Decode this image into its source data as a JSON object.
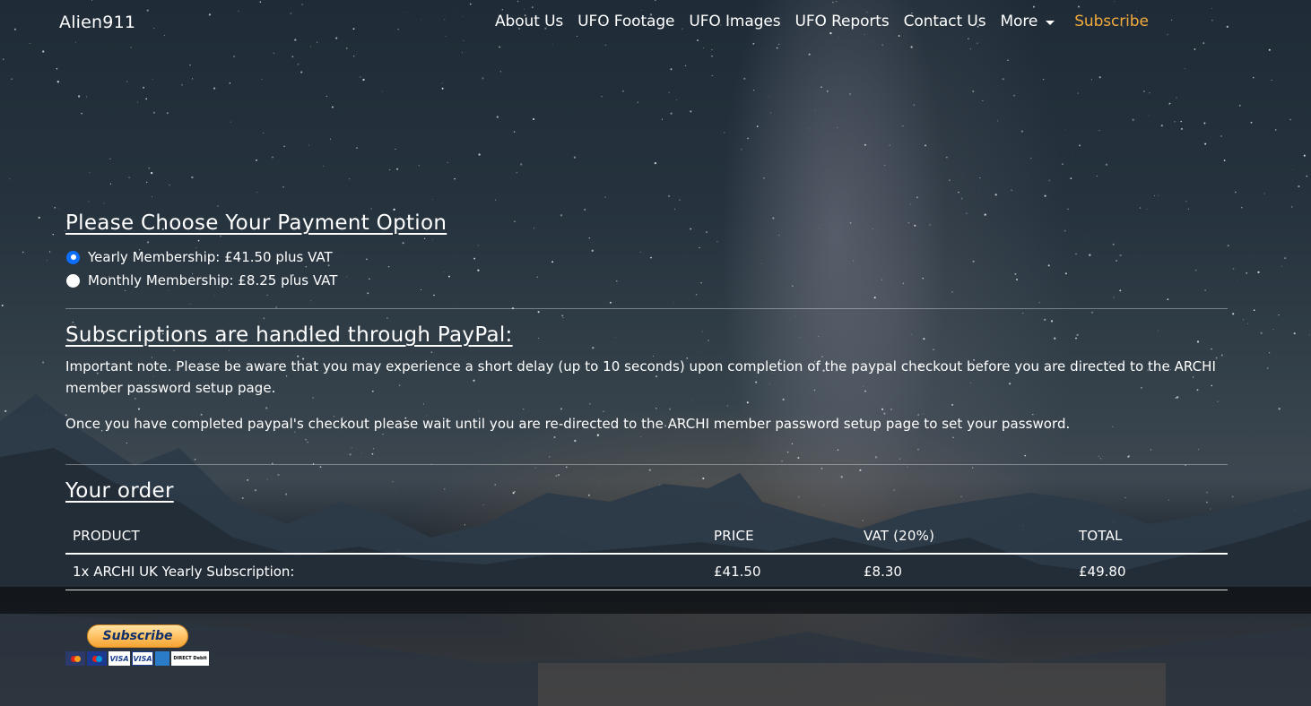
{
  "navbar": {
    "brand": "Alien911",
    "links": [
      {
        "label": "About Us"
      },
      {
        "label": "UFO Footage"
      },
      {
        "label": "UFO Images"
      },
      {
        "label": "UFO Reports"
      },
      {
        "label": "Contact Us"
      }
    ],
    "more_label": "More",
    "subscribe_label": "Subscribe",
    "subscribe_color": "#f3aa3c"
  },
  "payment": {
    "title": "Please Choose Your Payment Option",
    "options": [
      {
        "label": "Yearly Membership: £41.50 plus VAT",
        "checked": true
      },
      {
        "label": "Monthly Membership: £8.25 plus VAT",
        "checked": false
      }
    ]
  },
  "paypal": {
    "title": "Subscriptions are handled through PayPal:",
    "paragraphs": [
      "Important note. Please be aware that you may experience a short delay (up to 10 seconds) upon completion of the paypal checkout before you are directed to the ARCHI member password setup page.",
      "Once you have completed paypal's checkout please wait until you are re-directed to the ARCHI member password setup page to set your password."
    ]
  },
  "order": {
    "title": "Your order",
    "columns": [
      "PRODUCT",
      "PRICE",
      "VAT (20%)",
      "TOTAL"
    ],
    "rows": [
      {
        "product": "1x ARCHI UK Yearly Subscription:",
        "price": "£41.50",
        "vat": "£8.30",
        "total": "£49.80"
      }
    ]
  },
  "paypal_button": {
    "label": "Subscribe",
    "cards": [
      "MasterCard",
      "Maestro",
      "VISA",
      "VISA",
      "AMEX",
      "DIRECT Debit"
    ]
  },
  "colors": {
    "accent_radio": "#0d6efd",
    "text": "#ffffff"
  }
}
